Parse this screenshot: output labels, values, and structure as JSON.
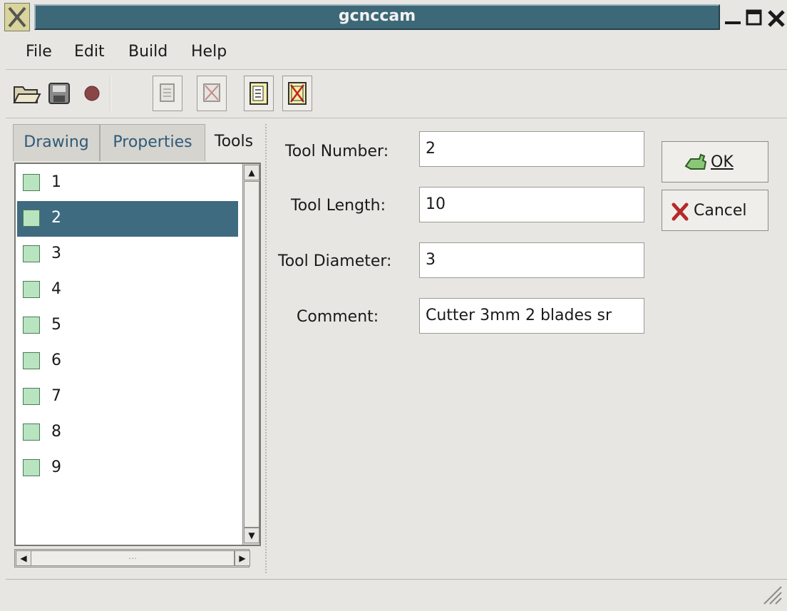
{
  "window": {
    "title": "gcnccam"
  },
  "menu": {
    "file": "File",
    "edit": "Edit",
    "build": "Build",
    "help": "Help"
  },
  "tabs": {
    "drawing": "Drawing",
    "properties": "Properties",
    "tools": "Tools"
  },
  "tools_list": [
    "1",
    "2",
    "3",
    "4",
    "5",
    "6",
    "7",
    "8",
    "9"
  ],
  "selected_tool": "2",
  "form": {
    "tool_number_label": "Tool Number:",
    "tool_number_value": "2",
    "tool_length_label": "Tool  Length:",
    "tool_length_value": "10",
    "tool_diameter_label": "Tool Diameter:",
    "tool_diameter_value": "3",
    "comment_label": "Comment:",
    "comment_value": "Cutter 3mm 2 blades sr"
  },
  "buttons": {
    "ok": "OK",
    "cancel": "Cancel"
  },
  "colors": {
    "selection": "#3f6b80",
    "title_bar": "#3d6878",
    "link_tab": "#2f5a78"
  },
  "icons": [
    "open-folder-icon",
    "save-icon",
    "record-icon",
    "properties-icon",
    "delete-icon",
    "tool-icon",
    "ok-hand-icon",
    "cancel-x-icon"
  ]
}
